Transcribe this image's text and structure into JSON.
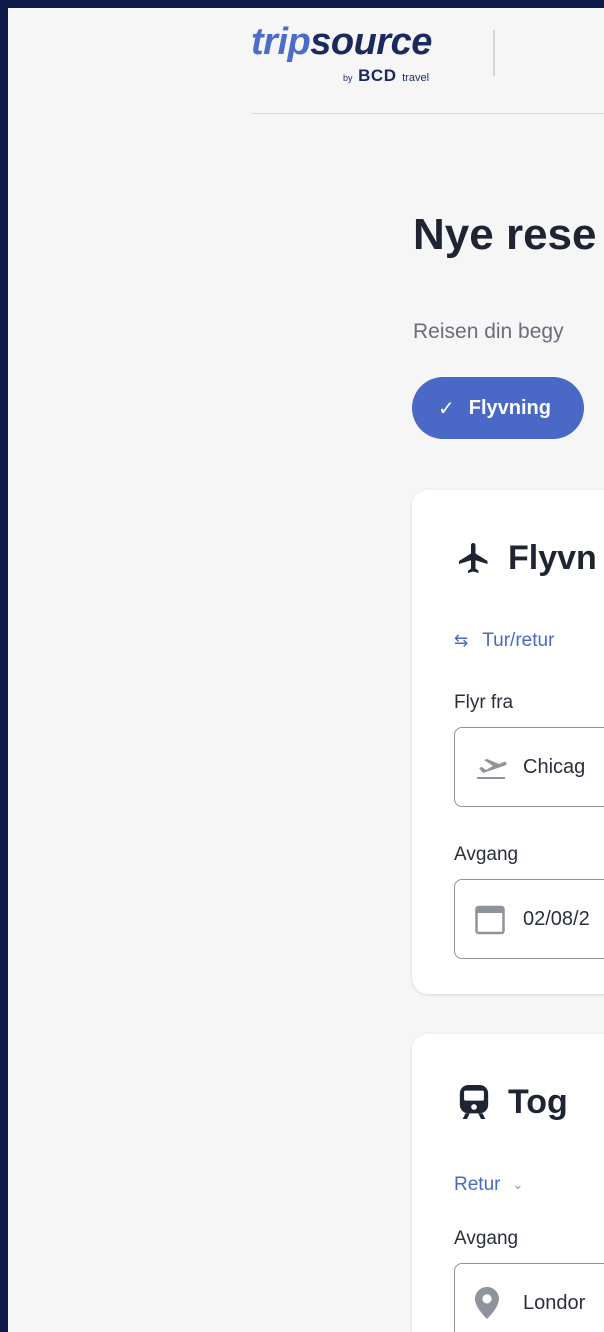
{
  "header": {
    "logo": {
      "trip": "trip",
      "source": "source",
      "by": "by",
      "bcd": "BCD",
      "travel": "travel"
    }
  },
  "page": {
    "title": "Nye rese",
    "subtitle": "Reisen din begy"
  },
  "chip": {
    "label": "Flyvning",
    "icon": "check-icon"
  },
  "flight": {
    "title": "Flyvn",
    "icon": "airplane-icon",
    "trip_type": "Tur/retur",
    "from_label": "Flyr fra",
    "from_value": "Chicag",
    "departure_label": "Avgang",
    "departure_value": "02/08/2"
  },
  "train": {
    "title": "Tog",
    "icon": "train-icon",
    "trip_type": "Retur",
    "departure_label": "Avgang",
    "departure_value": "Londor"
  },
  "colors": {
    "accent": "#4a68c6",
    "brand_dark": "#1a2a5e",
    "frame": "#0d1b4a"
  }
}
